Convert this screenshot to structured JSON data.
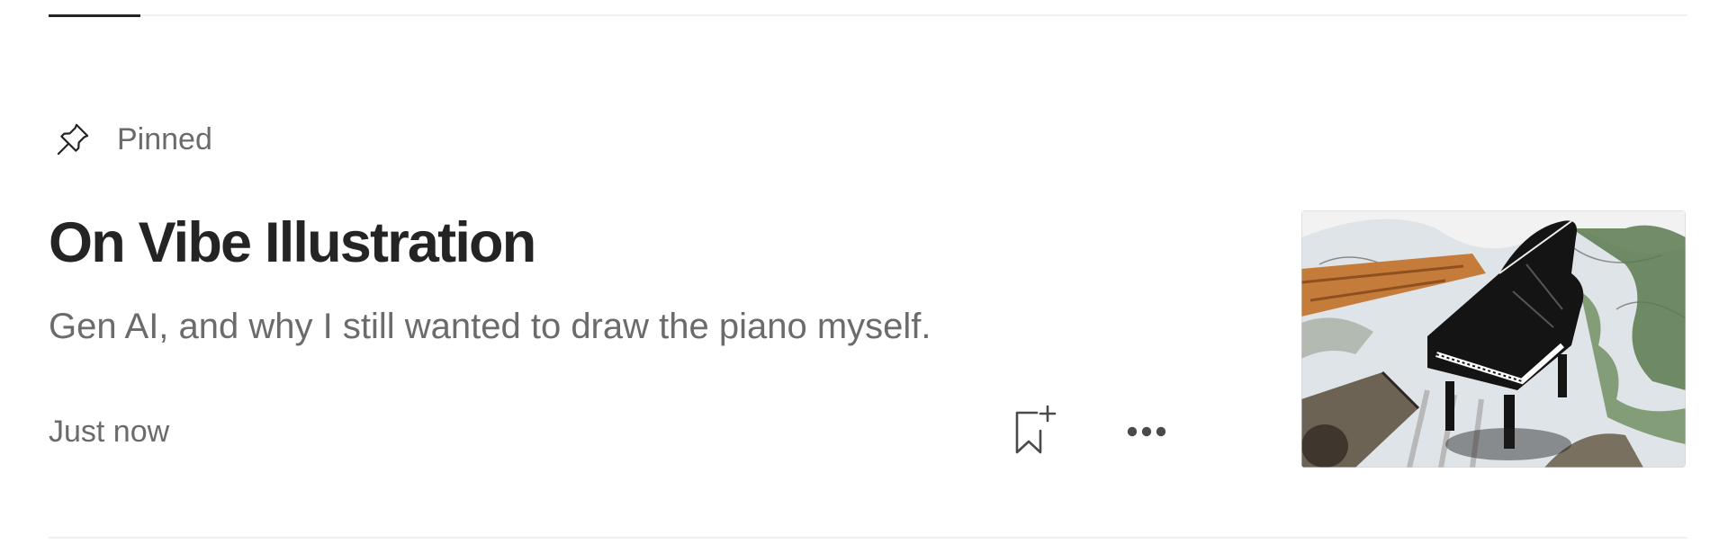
{
  "pinned": {
    "label": "Pinned",
    "icon": "pin-icon"
  },
  "post": {
    "title": "On Vibe Illustration",
    "subtitle": "Gen AI, and why I still wanted to draw the piano myself.",
    "time": "Just now",
    "thumbnail_alt": "Sketch-style illustration of a black grand piano among logs and trees"
  },
  "actions": {
    "bookmark_icon": "bookmark-add-icon",
    "more_icon": "more-horizontal-icon"
  },
  "colors": {
    "text_primary": "#242424",
    "text_secondary": "#6b6b6b",
    "divider": "#f0f0f0"
  }
}
